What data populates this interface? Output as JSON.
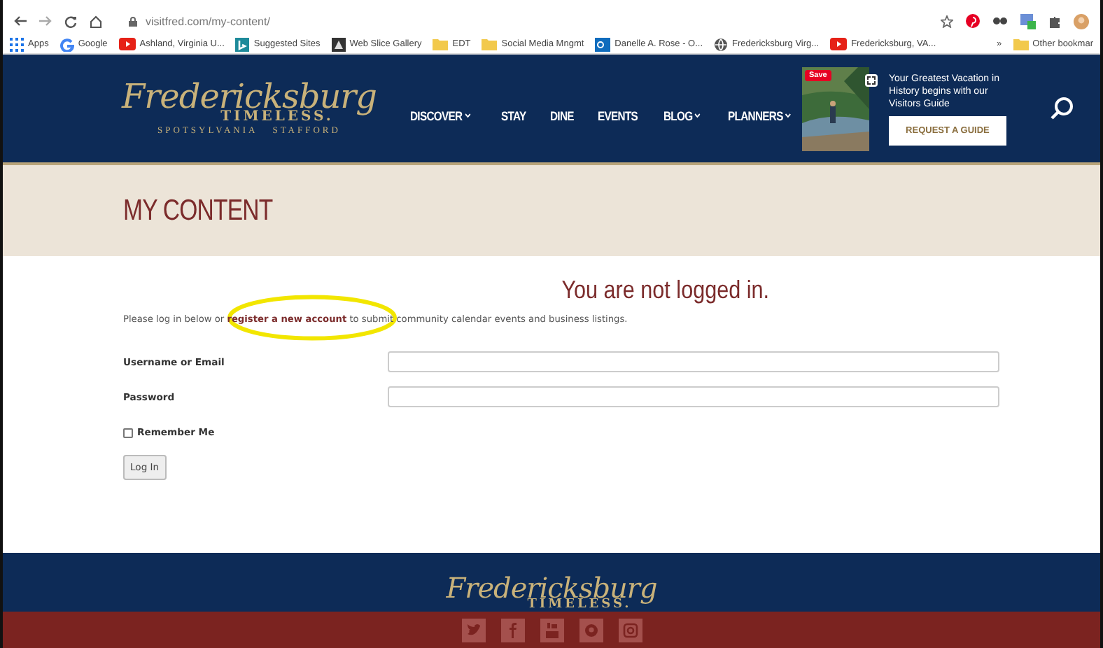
{
  "browser": {
    "url": "visitfred.com/my-content/",
    "bookmarks": [
      {
        "label": "Apps",
        "kind": "apps"
      },
      {
        "label": "Google",
        "kind": "google"
      },
      {
        "label": "Ashland, Virginia U...",
        "kind": "youtube"
      },
      {
        "label": "Suggested Sites",
        "kind": "bing"
      },
      {
        "label": "Web Slice Gallery",
        "kind": "slice"
      },
      {
        "label": "EDT",
        "kind": "folder"
      },
      {
        "label": "Social Media Mngmt",
        "kind": "folder"
      },
      {
        "label": "Danelle A. Rose - O...",
        "kind": "outlook"
      },
      {
        "label": "Fredericksburg Virg...",
        "kind": "globe"
      },
      {
        "label": "Fredericksburg, VA...",
        "kind": "youtube"
      }
    ],
    "overflow": "»",
    "other": "Other bookmar"
  },
  "header": {
    "logo": {
      "script": "Fredericksburg",
      "word": "TIMELESS.",
      "places": "SPOTSYLVANIA   STAFFORD"
    },
    "nav": [
      {
        "label": "DISCOVER",
        "dropdown": true
      },
      {
        "label": "STAY",
        "dropdown": false
      },
      {
        "label": "DINE",
        "dropdown": false
      },
      {
        "label": "EVENTS",
        "dropdown": false
      },
      {
        "label": "BLOG",
        "dropdown": true
      },
      {
        "label": "PLANNERS",
        "dropdown": true
      }
    ],
    "promo": {
      "badge": "Save",
      "text": "Your Greatest Vacation in History begins with our Visitors Guide",
      "button": "REQUEST A GUIDE"
    }
  },
  "page_title": "MY CONTENT",
  "login": {
    "heading": "You are not logged in.",
    "intro": "Please log in below or **register a new account** to submit community calendar events and business listings.",
    "fields": [
      {
        "label": "Username or Email"
      },
      {
        "label": "Password"
      }
    ],
    "remember": {
      "label": "Remember Me",
      "checked": false
    },
    "button": "Log In"
  },
  "footer": {
    "logo": {
      "script": "Fredericksburg",
      "word": "TIMELESS."
    },
    "social": [
      {
        "kind": "twitter"
      },
      {
        "kind": "facebook"
      },
      {
        "kind": "youtube"
      },
      {
        "kind": "pinterest"
      },
      {
        "kind": "instagram"
      }
    ]
  }
}
